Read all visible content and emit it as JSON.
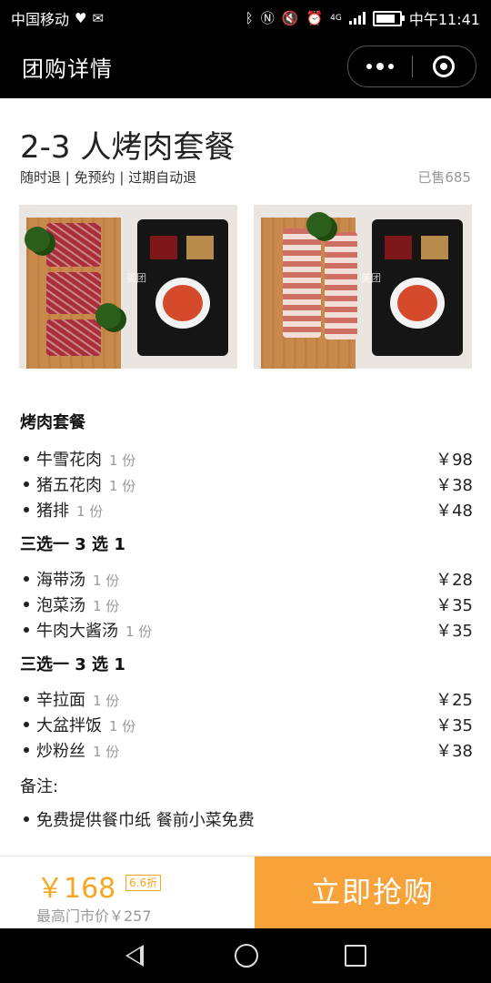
{
  "status_bar": {
    "carrier": "中国移动",
    "network": "4G",
    "time": "中午11:41",
    "battery_level": 0.85
  },
  "nav_bar": {
    "title": "团购详情"
  },
  "deal": {
    "title": "2-3 人烤肉套餐",
    "tags": "随时退 | 免预约 | 过期自动退",
    "sold": "已售685",
    "photo_watermark": "美团"
  },
  "menu": {
    "sections": [
      {
        "title": "烤肉套餐",
        "items": [
          {
            "name": "牛雪花肉",
            "qty": "1 份",
            "price": "￥98"
          },
          {
            "name": "猪五花肉",
            "qty": "1 份",
            "price": "￥38"
          },
          {
            "name": "猪排",
            "qty": "1 份",
            "price": "￥48"
          }
        ]
      },
      {
        "title": "三选一 3 选 1",
        "items": [
          {
            "name": "海带汤",
            "qty": "1 份",
            "price": "￥28"
          },
          {
            "name": "泡菜汤",
            "qty": "1 份",
            "price": "￥35"
          },
          {
            "name": "牛肉大酱汤",
            "qty": "1 份",
            "price": "￥35"
          }
        ]
      },
      {
        "title": "三选一 3 选 1",
        "items": [
          {
            "name": "辛拉面",
            "qty": "1 份",
            "price": "￥25"
          },
          {
            "name": "大盆拌饭",
            "qty": "1 份",
            "price": "￥35"
          },
          {
            "name": "炒粉丝",
            "qty": "1 份",
            "price": "￥38"
          }
        ]
      }
    ],
    "remark_title": "备注:",
    "remark_items": [
      "免费提供餐巾纸 餐前小菜免费"
    ]
  },
  "bottom_bar": {
    "price": "￥168",
    "discount": "6.6折",
    "market_price": "最高门市价￥257",
    "buy_label": "立即抢购"
  },
  "colors": {
    "accent": "#f8a23a",
    "price": "#f5a623"
  }
}
